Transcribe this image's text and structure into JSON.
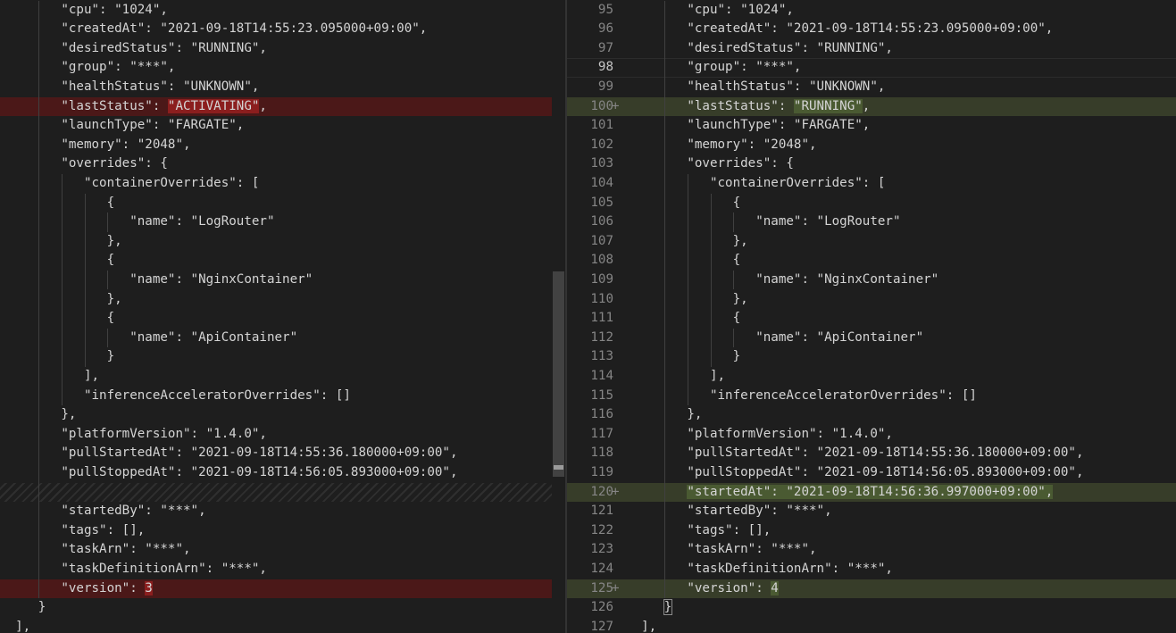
{
  "diff": {
    "left": {
      "lines": [
        {
          "text": "        \"cpu\": \"1024\","
        },
        {
          "text": "        \"createdAt\": \"2021-09-18T14:55:23.095000+09:00\","
        },
        {
          "text": "        \"desiredStatus\": \"RUNNING\","
        },
        {
          "text": "        \"group\": \"***\","
        },
        {
          "text": "        \"healthStatus\": \"UNKNOWN\","
        },
        {
          "text": "        \"lastStatus\": \"ACTIVATING\",",
          "state": "removed",
          "pre": "        \"lastStatus\": ",
          "hl": "\"ACTIVATING\"",
          "post": ","
        },
        {
          "text": "        \"launchType\": \"FARGATE\","
        },
        {
          "text": "        \"memory\": \"2048\","
        },
        {
          "text": "        \"overrides\": {"
        },
        {
          "text": "           \"containerOverrides\": ["
        },
        {
          "text": "              {"
        },
        {
          "text": "                 \"name\": \"LogRouter\""
        },
        {
          "text": "              },"
        },
        {
          "text": "              {"
        },
        {
          "text": "                 \"name\": \"NginxContainer\""
        },
        {
          "text": "              },"
        },
        {
          "text": "              {"
        },
        {
          "text": "                 \"name\": \"ApiContainer\""
        },
        {
          "text": "              }"
        },
        {
          "text": "           ],"
        },
        {
          "text": "           \"inferenceAcceleratorOverrides\": []"
        },
        {
          "text": "        },"
        },
        {
          "text": "        \"platformVersion\": \"1.4.0\","
        },
        {
          "text": "        \"pullStartedAt\": \"2021-09-18T14:55:36.180000+09:00\","
        },
        {
          "text": "        \"pullStoppedAt\": \"2021-09-18T14:56:05.893000+09:00\","
        },
        {
          "text": "",
          "state": "filler"
        },
        {
          "text": "        \"startedBy\": \"***\","
        },
        {
          "text": "        \"tags\": [],"
        },
        {
          "text": "        \"taskArn\": \"***\","
        },
        {
          "text": "        \"taskDefinitionArn\": \"***\","
        },
        {
          "text": "        \"version\": 3",
          "state": "removed",
          "pre": "        \"version\": ",
          "hl": "3",
          "post": ""
        },
        {
          "text": "     }"
        },
        {
          "text": "  ],"
        }
      ]
    },
    "right": {
      "lines": [
        {
          "num": "95",
          "text": "        \"cpu\": \"1024\","
        },
        {
          "num": "96",
          "text": "        \"createdAt\": \"2021-09-18T14:55:23.095000+09:00\","
        },
        {
          "num": "97",
          "text": "        \"desiredStatus\": \"RUNNING\","
        },
        {
          "num": "98",
          "text": "        \"group\": \"***\",",
          "state": "cursor"
        },
        {
          "num": "99",
          "text": "        \"healthStatus\": \"UNKNOWN\","
        },
        {
          "num": "100",
          "mark": "+",
          "text": "        \"lastStatus\": \"RUNNING\",",
          "state": "added",
          "pre": "        \"lastStatus\": ",
          "hl": "\"RUNNING\"",
          "post": ","
        },
        {
          "num": "101",
          "text": "        \"launchType\": \"FARGATE\","
        },
        {
          "num": "102",
          "text": "        \"memory\": \"2048\","
        },
        {
          "num": "103",
          "text": "        \"overrides\": {"
        },
        {
          "num": "104",
          "text": "           \"containerOverrides\": ["
        },
        {
          "num": "105",
          "text": "              {"
        },
        {
          "num": "106",
          "text": "                 \"name\": \"LogRouter\""
        },
        {
          "num": "107",
          "text": "              },"
        },
        {
          "num": "108",
          "text": "              {"
        },
        {
          "num": "109",
          "text": "                 \"name\": \"NginxContainer\""
        },
        {
          "num": "110",
          "text": "              },"
        },
        {
          "num": "111",
          "text": "              {"
        },
        {
          "num": "112",
          "text": "                 \"name\": \"ApiContainer\""
        },
        {
          "num": "113",
          "text": "              }"
        },
        {
          "num": "114",
          "text": "           ],"
        },
        {
          "num": "115",
          "text": "           \"inferenceAcceleratorOverrides\": []"
        },
        {
          "num": "116",
          "text": "        },"
        },
        {
          "num": "117",
          "text": "        \"platformVersion\": \"1.4.0\","
        },
        {
          "num": "118",
          "text": "        \"pullStartedAt\": \"2021-09-18T14:55:36.180000+09:00\","
        },
        {
          "num": "119",
          "text": "        \"pullStoppedAt\": \"2021-09-18T14:56:05.893000+09:00\","
        },
        {
          "num": "120",
          "mark": "+",
          "text": "        \"startedAt\": \"2021-09-18T14:56:36.997000+09:00\",",
          "state": "added",
          "pre": "        ",
          "hl": "\"startedAt\": \"2021-09-18T14:56:36.997000+09:00\",",
          "post": ""
        },
        {
          "num": "121",
          "text": "        \"startedBy\": \"***\","
        },
        {
          "num": "122",
          "text": "        \"tags\": [],"
        },
        {
          "num": "123",
          "text": "        \"taskArn\": \"***\","
        },
        {
          "num": "124",
          "text": "        \"taskDefinitionArn\": \"***\","
        },
        {
          "num": "125",
          "mark": "+",
          "text": "        \"version\": 4",
          "state": "added",
          "pre": "        \"version\": ",
          "hl": "4",
          "post": ""
        },
        {
          "num": "126",
          "text": "     }",
          "bracket": true
        },
        {
          "num": "127",
          "text": "  ],"
        }
      ]
    }
  }
}
